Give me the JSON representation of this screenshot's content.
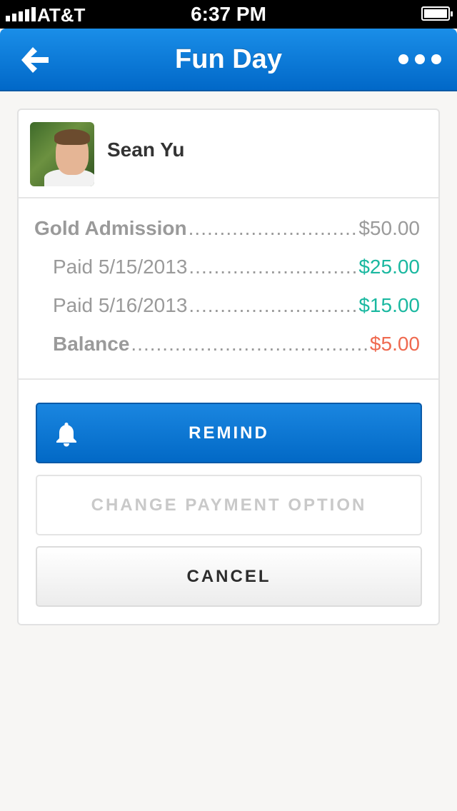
{
  "status_bar": {
    "carrier": "AT&T",
    "time": "6:37 PM"
  },
  "nav": {
    "title": "Fun Day",
    "back_icon": "back-arrow-icon",
    "more_icon": "more-dots-icon",
    "color": "#0a7bd9"
  },
  "person": {
    "name": "Sean Yu"
  },
  "ledger": [
    {
      "label": "Gold Admission",
      "amount": "$50.00",
      "color": "#9a9a9a"
    },
    {
      "label": "Paid 5/15/2013",
      "amount": "$25.00",
      "color": "#1ab8a0"
    },
    {
      "label": "Paid 5/16/2013",
      "amount": "$15.00",
      "color": "#1ab8a0"
    },
    {
      "label": "Balance",
      "amount": "$5.00",
      "color": "#ef6a50"
    }
  ],
  "actions": {
    "remind_label": "REMIND",
    "change_label": "CHANGE PAYMENT OPTION",
    "cancel_label": "CANCEL"
  }
}
